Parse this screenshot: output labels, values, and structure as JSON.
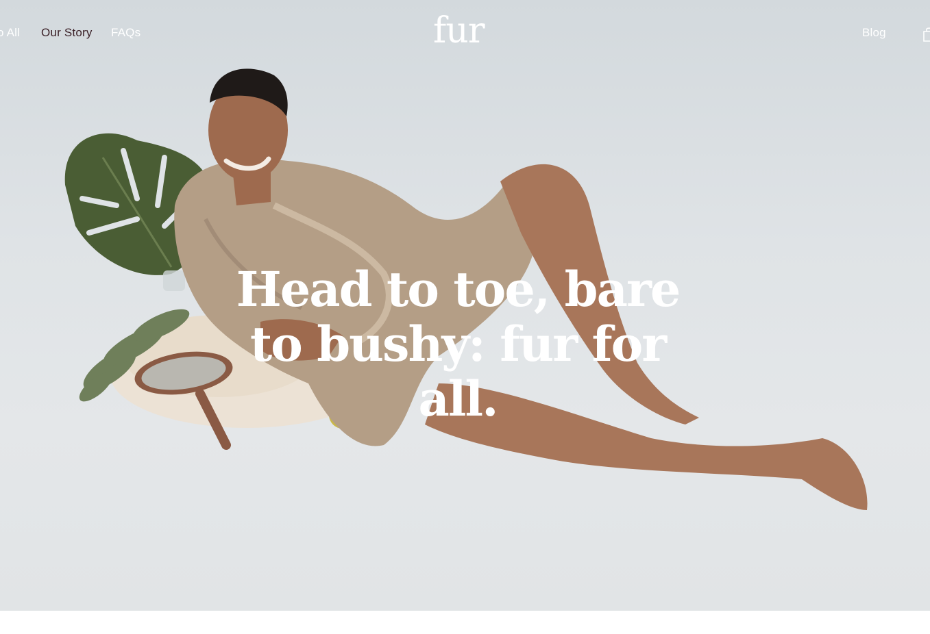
{
  "header": {
    "nav_left": [
      {
        "label": "o All"
      },
      {
        "label": "Our Story"
      },
      {
        "label": "FAQs"
      }
    ],
    "logo": "fur",
    "nav_right": [
      {
        "label": "Blog"
      }
    ],
    "cart_icon": "shopping-bag-icon"
  },
  "hero": {
    "headline": "Head to toe, bare to bushy: fur for all.",
    "image": "person-lounging-in-satin-robe-with-monstera-leaf-mirror-and-oil-bottle"
  },
  "colors": {
    "nav_text": "#ffffff",
    "nav_active": "#3a1f26",
    "hero_bg": "#dfe3e6"
  }
}
